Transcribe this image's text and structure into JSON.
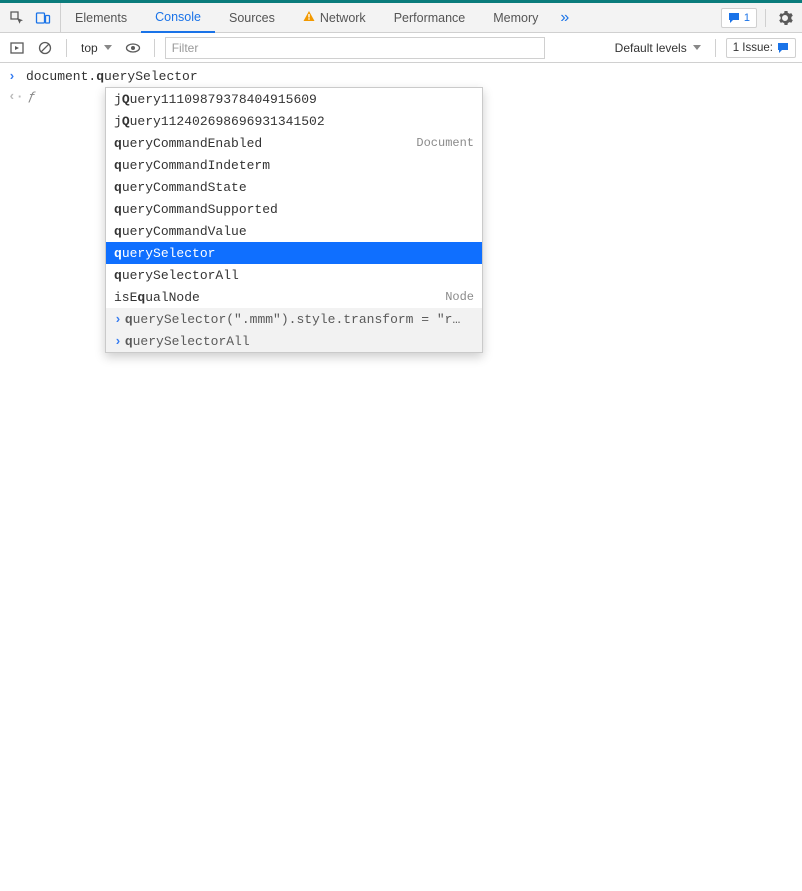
{
  "tabs": {
    "elements": "Elements",
    "console": "Console",
    "sources": "Sources",
    "network": "Network",
    "performance": "Performance",
    "memory": "Memory"
  },
  "errors_count": "1",
  "toolbar": {
    "context": "top",
    "filter_placeholder": "Filter",
    "levels": "Default levels",
    "issues_label": "1 Issue:"
  },
  "console": {
    "input_prefix": "document.",
    "input_bold": "q",
    "input_suffix": "uerySelector",
    "eager_eval": "ƒ"
  },
  "autocomplete": {
    "items": [
      {
        "pre": "j",
        "bold": "Q",
        "post": "uery11109879378404915609",
        "hint": "",
        "selected": false,
        "history": false
      },
      {
        "pre": "j",
        "bold": "Q",
        "post": "uery112402698696931341502",
        "hint": "",
        "selected": false,
        "history": false
      },
      {
        "pre": "",
        "bold": "q",
        "post": "ueryCommandEnabled",
        "hint": "Document",
        "selected": false,
        "history": false
      },
      {
        "pre": "",
        "bold": "q",
        "post": "ueryCommandIndeterm",
        "hint": "",
        "selected": false,
        "history": false
      },
      {
        "pre": "",
        "bold": "q",
        "post": "ueryCommandState",
        "hint": "",
        "selected": false,
        "history": false
      },
      {
        "pre": "",
        "bold": "q",
        "post": "ueryCommandSupported",
        "hint": "",
        "selected": false,
        "history": false
      },
      {
        "pre": "",
        "bold": "q",
        "post": "ueryCommandValue",
        "hint": "",
        "selected": false,
        "history": false
      },
      {
        "pre": "",
        "bold": "q",
        "post": "uerySelector",
        "hint": "",
        "selected": true,
        "history": false
      },
      {
        "pre": "",
        "bold": "q",
        "post": "uerySelectorAll",
        "hint": "",
        "selected": false,
        "history": false
      },
      {
        "pre": "isE",
        "bold": "q",
        "post": "ualNode",
        "hint": "Node",
        "selected": false,
        "history": false
      },
      {
        "pre": "",
        "bold": "q",
        "post": "uerySelector(\".mmm\").style.transform = \"r…",
        "hint": "",
        "selected": false,
        "history": true
      },
      {
        "pre": "",
        "bold": "q",
        "post": "uerySelectorAll",
        "hint": "",
        "selected": false,
        "history": true
      }
    ]
  }
}
